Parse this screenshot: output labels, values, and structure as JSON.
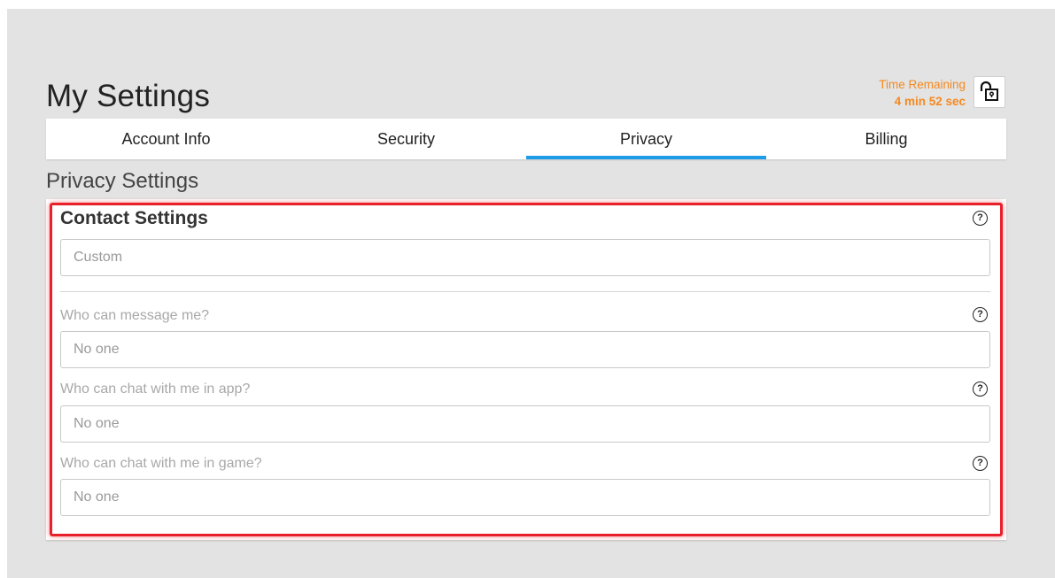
{
  "header": {
    "title": "My Settings",
    "timer": {
      "label": "Time Remaining",
      "value": "4 min 52 sec",
      "color": "#f5891f"
    },
    "lock_icon": "unlock-icon"
  },
  "tabs": [
    {
      "label": "Account Info",
      "active": false
    },
    {
      "label": "Security",
      "active": false
    },
    {
      "label": "Privacy",
      "active": true
    },
    {
      "label": "Billing",
      "active": false
    }
  ],
  "accent_color": "#1e9ce8",
  "highlight_color": "#e8202a",
  "privacy": {
    "section_title": "Privacy Settings",
    "contact": {
      "heading": "Contact Settings",
      "value": "Custom",
      "help_icon": "help-icon"
    },
    "fields": [
      {
        "label": "Who can message me?",
        "value": "No one"
      },
      {
        "label": "Who can chat with me in app?",
        "value": "No one"
      },
      {
        "label": "Who can chat with me in game?",
        "value": "No one"
      }
    ]
  }
}
